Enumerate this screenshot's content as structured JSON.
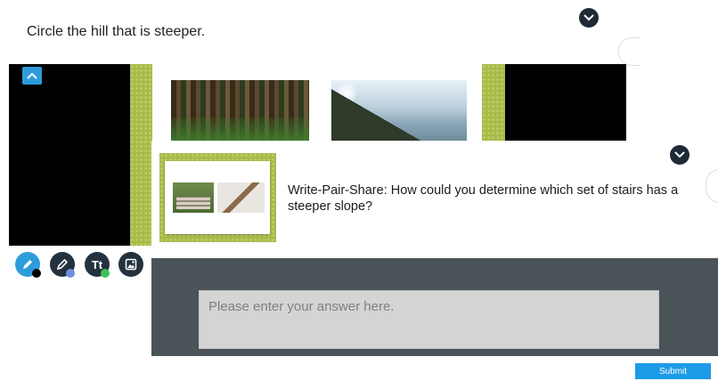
{
  "prompt": {
    "text": "Circle the hill that is steeper."
  },
  "slide": {
    "images": [
      "forest-hill-photo",
      "mountain-slope-photo"
    ]
  },
  "tools": [
    {
      "icon": "pencil-icon",
      "color": "#000000"
    },
    {
      "icon": "highlighter-icon",
      "color": "#6f8fe0"
    },
    {
      "icon": "text-tool-icon",
      "label": "Tt",
      "color": "#3cc15a"
    },
    {
      "icon": "image-icon"
    }
  ],
  "card": {
    "question": "Write-Pair-Share: How could you determine which set of stairs has a steeper slope?",
    "thumbnail": "stairs-comparison-image"
  },
  "answer": {
    "placeholder": "Please enter your answer here.",
    "value": ""
  },
  "submit": {
    "label": "Submit"
  },
  "colors": {
    "accent": "#2d9cdb",
    "submit": "#1e9be6",
    "frame_green": "#a7bb4a",
    "dark": "#24323e",
    "panel": "#4a5458"
  }
}
